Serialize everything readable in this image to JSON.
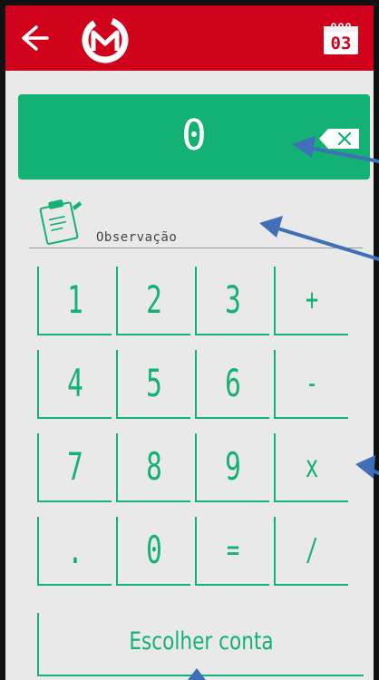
{
  "header": {
    "back_icon": "arrow-left-icon",
    "logo_icon": "app-logo-icon",
    "calendar_day": "03",
    "bar_color": "#d0021b"
  },
  "display": {
    "value": "0",
    "backspace_icon": "backspace-icon",
    "color": "#13b173"
  },
  "observation": {
    "label": "Observação",
    "icon": "clipboard-icon"
  },
  "keypad": {
    "keys": [
      "1",
      "2",
      "3",
      "+",
      "4",
      "5",
      "6",
      "-",
      "7",
      "8",
      "9",
      "x",
      ".",
      "0",
      "=",
      "/"
    ]
  },
  "footer": {
    "choose_account_label": "Escolher conta"
  },
  "annotation_color": "#3f6fb7"
}
